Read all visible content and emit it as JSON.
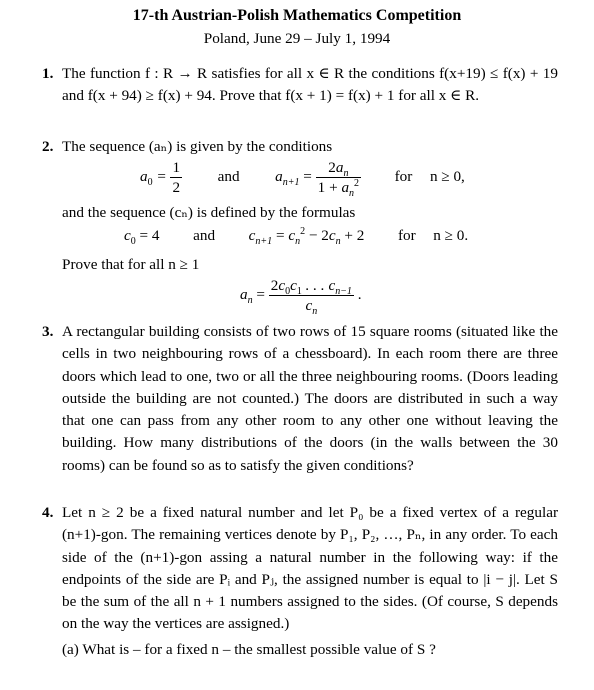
{
  "header": {
    "title": "17-th Austrian-Polish Mathematics Competition",
    "subtitle": "Poland, June 29 – July 1, 1994"
  },
  "problems": [
    {
      "number": "1.",
      "text": "The function f : R → R satisfies for all x ∈ R the conditions f(x+19) ≤ f(x) + 19 and f(x + 94) ≥ f(x) + 94. Prove that f(x + 1) = f(x) + 1 for all x ∈ R."
    },
    {
      "number": "2.",
      "intro": "The sequence (aₙ) is given by the conditions",
      "eq1": {
        "lhs": "a₀ = 1/2",
        "and": "and",
        "rhs": "aₙ₊₁ = 2aₙ / (1 + aₙ²)",
        "cond_for": "for",
        "cond": "n ≥ 0,"
      },
      "mid": "and the sequence (cₙ) is defined by the formulas",
      "eq2": {
        "lhs": "c₀ = 4",
        "and": "and",
        "rhs": "cₙ₊₁ = cₙ² − 2cₙ + 2",
        "cond_for": "for",
        "cond": "n ≥ 0."
      },
      "prove": "Prove that for all n ≥ 1",
      "eq3": "aₙ = 2c₀c₁…cₙ₋₁ / cₙ ."
    },
    {
      "number": "3.",
      "text": "A rectangular building consists of two rows of 15 square rooms (situated like the cells in two neighbouring rows of a chessboard). In each room there are three doors which lead to one, two or all the three neighbouring rooms. (Doors leading outside the building are not counted.) The doors are distributed in such a way that one can pass from any other room to any other one without leaving the building. How many distributions of the doors (in the walls between the 30 rooms) can be found so as to satisfy the given conditions?"
    },
    {
      "number": "4.",
      "text": "Let n ≥ 2 be a fixed natural number and let P₀ be a fixed vertex of a regular (n+1)-gon. The remaining vertices denote by P₁, P₂, …, Pₙ, in any order. To each side of the (n+1)-gon assing a natural number in the following way: if the endpoints of the side are Pᵢ and Pⱼ, the assigned number is equal to |i − j|. Let S be the sum of the all n + 1 numbers assigned to the sides. (Of course, S depends on the way the vertices are assigned.)",
      "part_a": "(a) What is – for a fixed n – the smallest possible value of S ?"
    }
  ]
}
